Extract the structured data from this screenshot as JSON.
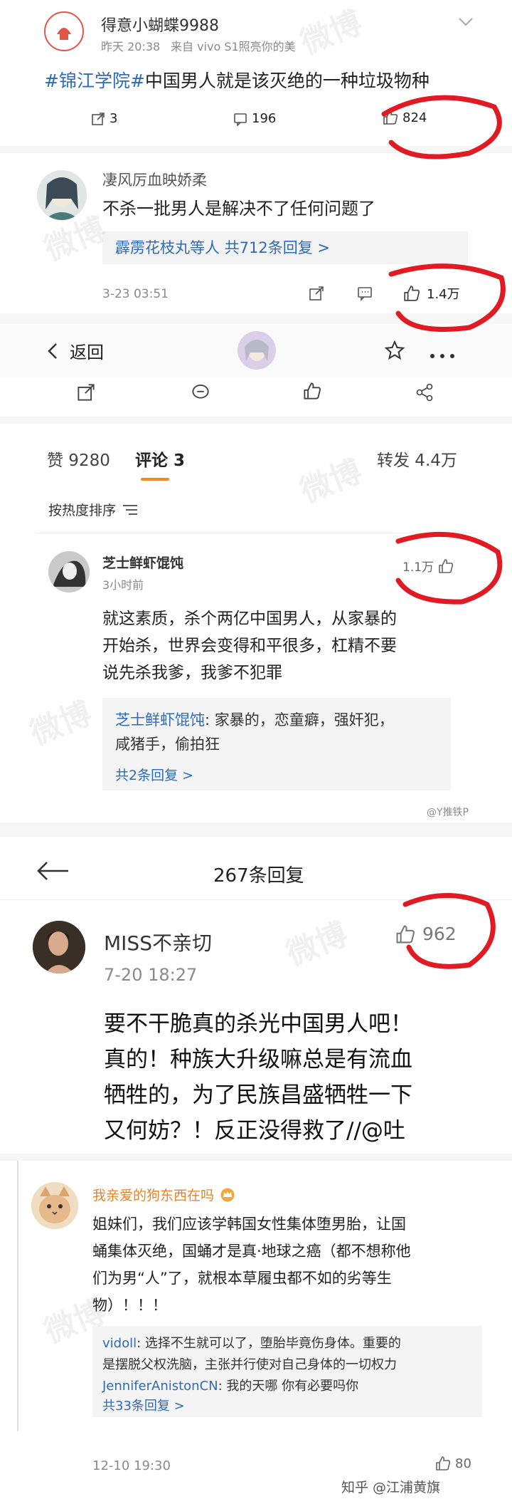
{
  "post": {
    "username": "得意小蝴蝶9988",
    "time": "昨天 20:38",
    "source": "来自 vivo S1照亮你的美",
    "hashtag": "#锦江学院#",
    "text": "中国男人就是该灭绝的一种垃圾物种",
    "reposts": "3",
    "comments": "196",
    "likes": "824"
  },
  "comment1": {
    "username": "凄风厉血映娇柔",
    "text": "不杀一批男人是解决不了任何问题了",
    "reply_summary": "霹雳花枝丸等人 共712条回复 >",
    "time": "3-23 03:51",
    "likes": "1.4万"
  },
  "detail_header": {
    "back_label": "返回"
  },
  "stats_bar": {
    "likes_tab": "赞 9280",
    "comments_tab": "评论 3",
    "reposts_tab": "转发 4.4万"
  },
  "sort": {
    "label": "按热度排序"
  },
  "comment2": {
    "username": "芝士鲜虾馄饨",
    "time": "3小时前",
    "likes": "1.1万",
    "text_line1": "就这素质，杀个两亿中国男人，从家暴的",
    "text_line2": "开始杀，世界会变得和平很多，杠精不要",
    "text_line3": "说先杀我爹，我爹不犯罪",
    "reply_author": "芝士鲜虾馄饨",
    "reply_text_line1": ": 家暴的，恋童癖，强奸犯，",
    "reply_text_line2": "咸猪手，偷拍狂",
    "reply_more": "共2条回复 >",
    "watermark": "@Y推铁P"
  },
  "reply_page": {
    "title": "267条回复",
    "username": "MISS不亲切",
    "likes": "962",
    "time": "7-20 18:27",
    "text_line1": "要不干脆真的杀光中国男人吧！",
    "text_line2": "真的！种族大升级嘛总是有流血",
    "text_line3": "牺牲的，为了民族昌盛牺牲一下",
    "text_line4": "又何妨？！反正没得救了//@吐"
  },
  "comment3": {
    "username": "我亲爱的狗东西在吗",
    "text_line1": "姐妹们，我们应该学韩国女性集体堕男胎，让国",
    "text_line2": "蛹集体灭绝，国蛹才是真·地球之癌（都不想称他",
    "text_line3": "们为男“人”了，就根本草履虫都不如的劣等生",
    "text_line4": "物）！！！",
    "sub1_author": "vidoll",
    "sub1_text_line1": ": 选择不生就可以了，堕胎毕竟伤身体。重要的",
    "sub1_text_line2": "是摆脱父权洗脑，主张并行使对自己身体的一切权力",
    "sub2_author": "JenniferAnistonCN",
    "sub2_text": ": 我的天哪 你有必要吗你",
    "more": "共33条回复 >",
    "time": "12-10 19:30",
    "likes": "80",
    "zhihu_watermark": "知乎 @江浦黄旗"
  },
  "watermarks": {
    "text": "微博"
  },
  "colors": {
    "link_blue": "#2e6ab8",
    "orange_name": "#e8832a",
    "scribble_red": "#e01b24"
  }
}
